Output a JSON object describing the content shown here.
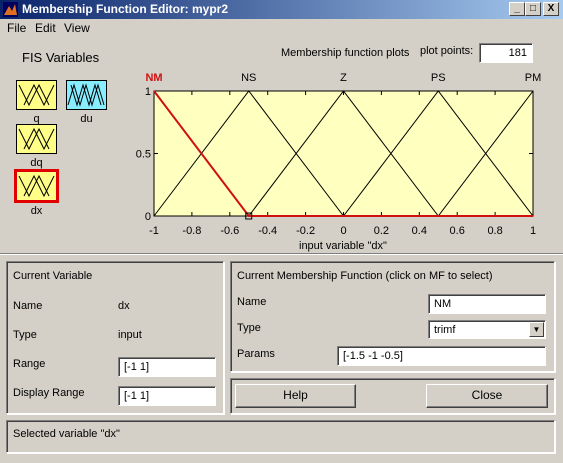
{
  "window": {
    "title": "Membership Function Editor: mypr2",
    "min_glyph": "_",
    "max_glyph": "□",
    "close_glyph": "X"
  },
  "menu": [
    "File",
    "Edit",
    "View"
  ],
  "fis_variables": {
    "heading": "FIS Variables",
    "items": [
      {
        "name": "q",
        "kind": "input",
        "selected": false
      },
      {
        "name": "du",
        "kind": "output",
        "selected": false
      },
      {
        "name": "dq",
        "kind": "input",
        "selected": false
      },
      {
        "name": "dx",
        "kind": "input",
        "selected": true
      }
    ]
  },
  "plot": {
    "heading": "Membership function plots",
    "plot_points_label": "plot points:",
    "plot_points_value": "181",
    "xlabel": "input variable \"dx\"",
    "background": "#ffffc0",
    "highlight_color": "#d01010"
  },
  "chart_data": {
    "type": "line",
    "xlim": [
      -1,
      1
    ],
    "ylim": [
      0,
      1
    ],
    "xticks": [
      "-1",
      "-0.8",
      "-0.6",
      "-0.4",
      "-0.2",
      "0",
      "0.2",
      "0.4",
      "0.6",
      "0.8",
      "1"
    ],
    "yticks": [
      "0",
      "0.5",
      "1"
    ],
    "xlabel": "input variable \"dx\"",
    "series": [
      {
        "name": "NM",
        "params": [
          -1.5,
          -1,
          -0.5
        ],
        "selected": true
      },
      {
        "name": "NS",
        "params": [
          -1,
          -0.5,
          0
        ],
        "selected": false
      },
      {
        "name": "Z",
        "params": [
          -0.5,
          0,
          0.5
        ],
        "selected": false
      },
      {
        "name": "PS",
        "params": [
          0,
          0.5,
          1
        ],
        "selected": false
      },
      {
        "name": "PM",
        "params": [
          0.5,
          1,
          1.5
        ],
        "selected": false
      }
    ]
  },
  "current_variable": {
    "heading": "Current Variable",
    "name_label": "Name",
    "name_value": "dx",
    "type_label": "Type",
    "type_value": "input",
    "range_label": "Range",
    "range_value": "[-1 1]",
    "display_range_label": "Display Range",
    "display_range_value": "[-1 1]"
  },
  "current_mf": {
    "heading": "Current Membership Function (click on MF to select)",
    "name_label": "Name",
    "name_value": "NM",
    "type_label": "Type",
    "type_value": "trimf",
    "params_label": "Params",
    "params_value": "[-1.5 -1 -0.5]"
  },
  "buttons": {
    "help": "Help",
    "close": "Close"
  },
  "status": "Selected variable \"dx\""
}
